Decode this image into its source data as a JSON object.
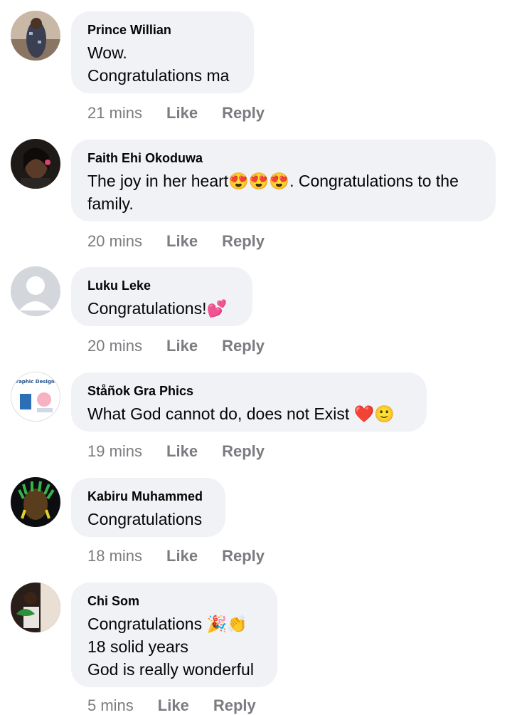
{
  "comments": [
    {
      "author": "Prince Willian",
      "lines": [
        "Wow.",
        "Congratulations ma"
      ],
      "time": "21 mins",
      "like": "Like",
      "reply": "Reply"
    },
    {
      "author": "Faith Ehi Okoduwa",
      "lines": [
        "The joy in her heart😍😍😍. Congratulations to the",
        "family."
      ],
      "time": "20 mins",
      "like": "Like",
      "reply": "Reply"
    },
    {
      "author": "Luku  Leke",
      "lines": [
        "Congratulations!💕"
      ],
      "time": "20 mins",
      "like": "Like",
      "reply": "Reply"
    },
    {
      "author": "Ståñok Gra Phics",
      "lines": [
        "What God cannot do, does not Exist ❤️🙂"
      ],
      "time": "19 mins",
      "like": "Like",
      "reply": "Reply"
    },
    {
      "author": "Kabiru Muhammed",
      "lines": [
        "Congratulations"
      ],
      "time": "18 mins",
      "like": "Like",
      "reply": "Reply"
    },
    {
      "author": "Chi Som",
      "lines": [
        "Congratulations 🎉👏",
        "18 solid years",
        "God is really wonderful"
      ],
      "time": "5 mins",
      "like": "Like",
      "reply": "Reply"
    }
  ],
  "avatar_logo_text": "Graphic Designer"
}
